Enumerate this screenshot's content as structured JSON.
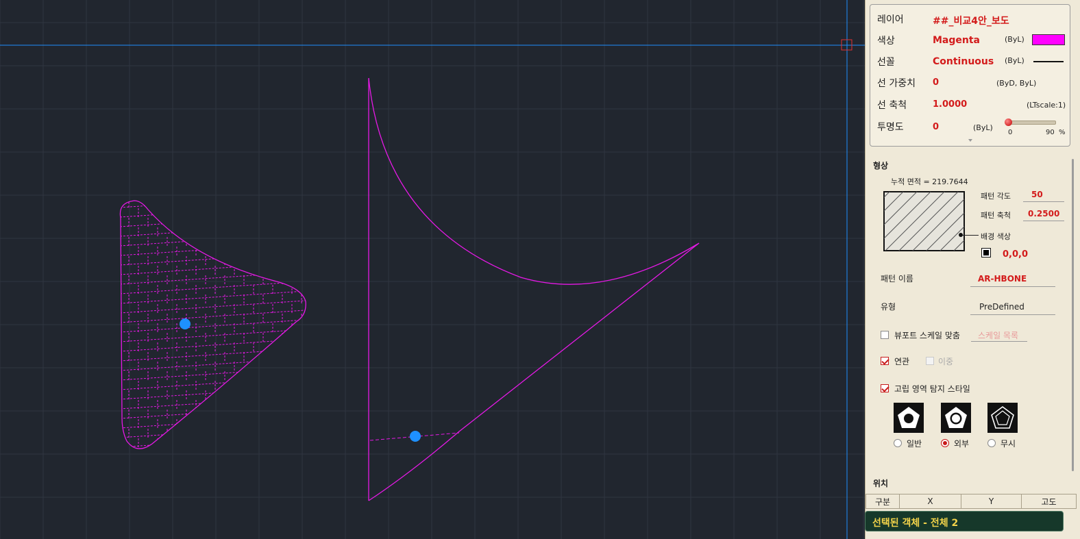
{
  "colors": {
    "canvas_bg": "#21262f",
    "grid": "#2f3540",
    "entity": "#e619e6",
    "grip": "#1e90ff",
    "crosshair": "#1e8fff",
    "accent_red": "#d31b1b"
  },
  "properties": {
    "layer": {
      "label": "레이어",
      "value": "##_비교4안_보도"
    },
    "color": {
      "label": "색상",
      "value": "Magenta",
      "by": "(ByL)"
    },
    "linetype": {
      "label": "선꼴",
      "value": "Continuous",
      "by": "(ByL)"
    },
    "lineweight": {
      "label": "선 가중치",
      "value": "0",
      "by": "(ByD, ByL)"
    },
    "ltscale": {
      "label": "선 축척",
      "value": "1.0000",
      "by": "(LTscale:1)"
    },
    "transparency": {
      "label": "투명도",
      "value": "0",
      "by": "(ByL)",
      "min": "0",
      "max": "90",
      "unit": "%",
      "level_fraction": 0
    }
  },
  "shape": {
    "section_title": "형상",
    "area_text": "누적 면적 = 219.7644",
    "pattern_angle": {
      "label": "패턴 각도",
      "value": "50"
    },
    "pattern_scale": {
      "label": "패턴 축척",
      "value": "0.2500"
    },
    "bg_color": {
      "label": "배경 색상",
      "value": "0,0,0"
    },
    "pattern_name": {
      "label": "패턴 이름",
      "value": "AR-HBONE"
    },
    "type": {
      "label": "유형",
      "value": "PreDefined"
    },
    "viewport_scale": {
      "label": "뷰포트 스케일 맞춤",
      "checked": false,
      "button": "스케일 목록"
    },
    "associative": {
      "label": "연관",
      "checked": true
    },
    "double": {
      "label": "이중",
      "checked": false
    },
    "island": {
      "label": "고립 영역 탐지 스타일",
      "checked": true
    },
    "island_styles": [
      {
        "label": "일반",
        "icon": "pentagon-normal-icon",
        "selected": false
      },
      {
        "label": "외부",
        "icon": "pentagon-outer-icon",
        "selected": true
      },
      {
        "label": "무시",
        "icon": "pentagon-ignore-icon",
        "selected": false
      }
    ]
  },
  "position": {
    "section_title": "위치",
    "headers": [
      "구분",
      "X",
      "Y",
      "고도"
    ]
  },
  "status": {
    "text": "선택된 객체 -  전체 2"
  }
}
